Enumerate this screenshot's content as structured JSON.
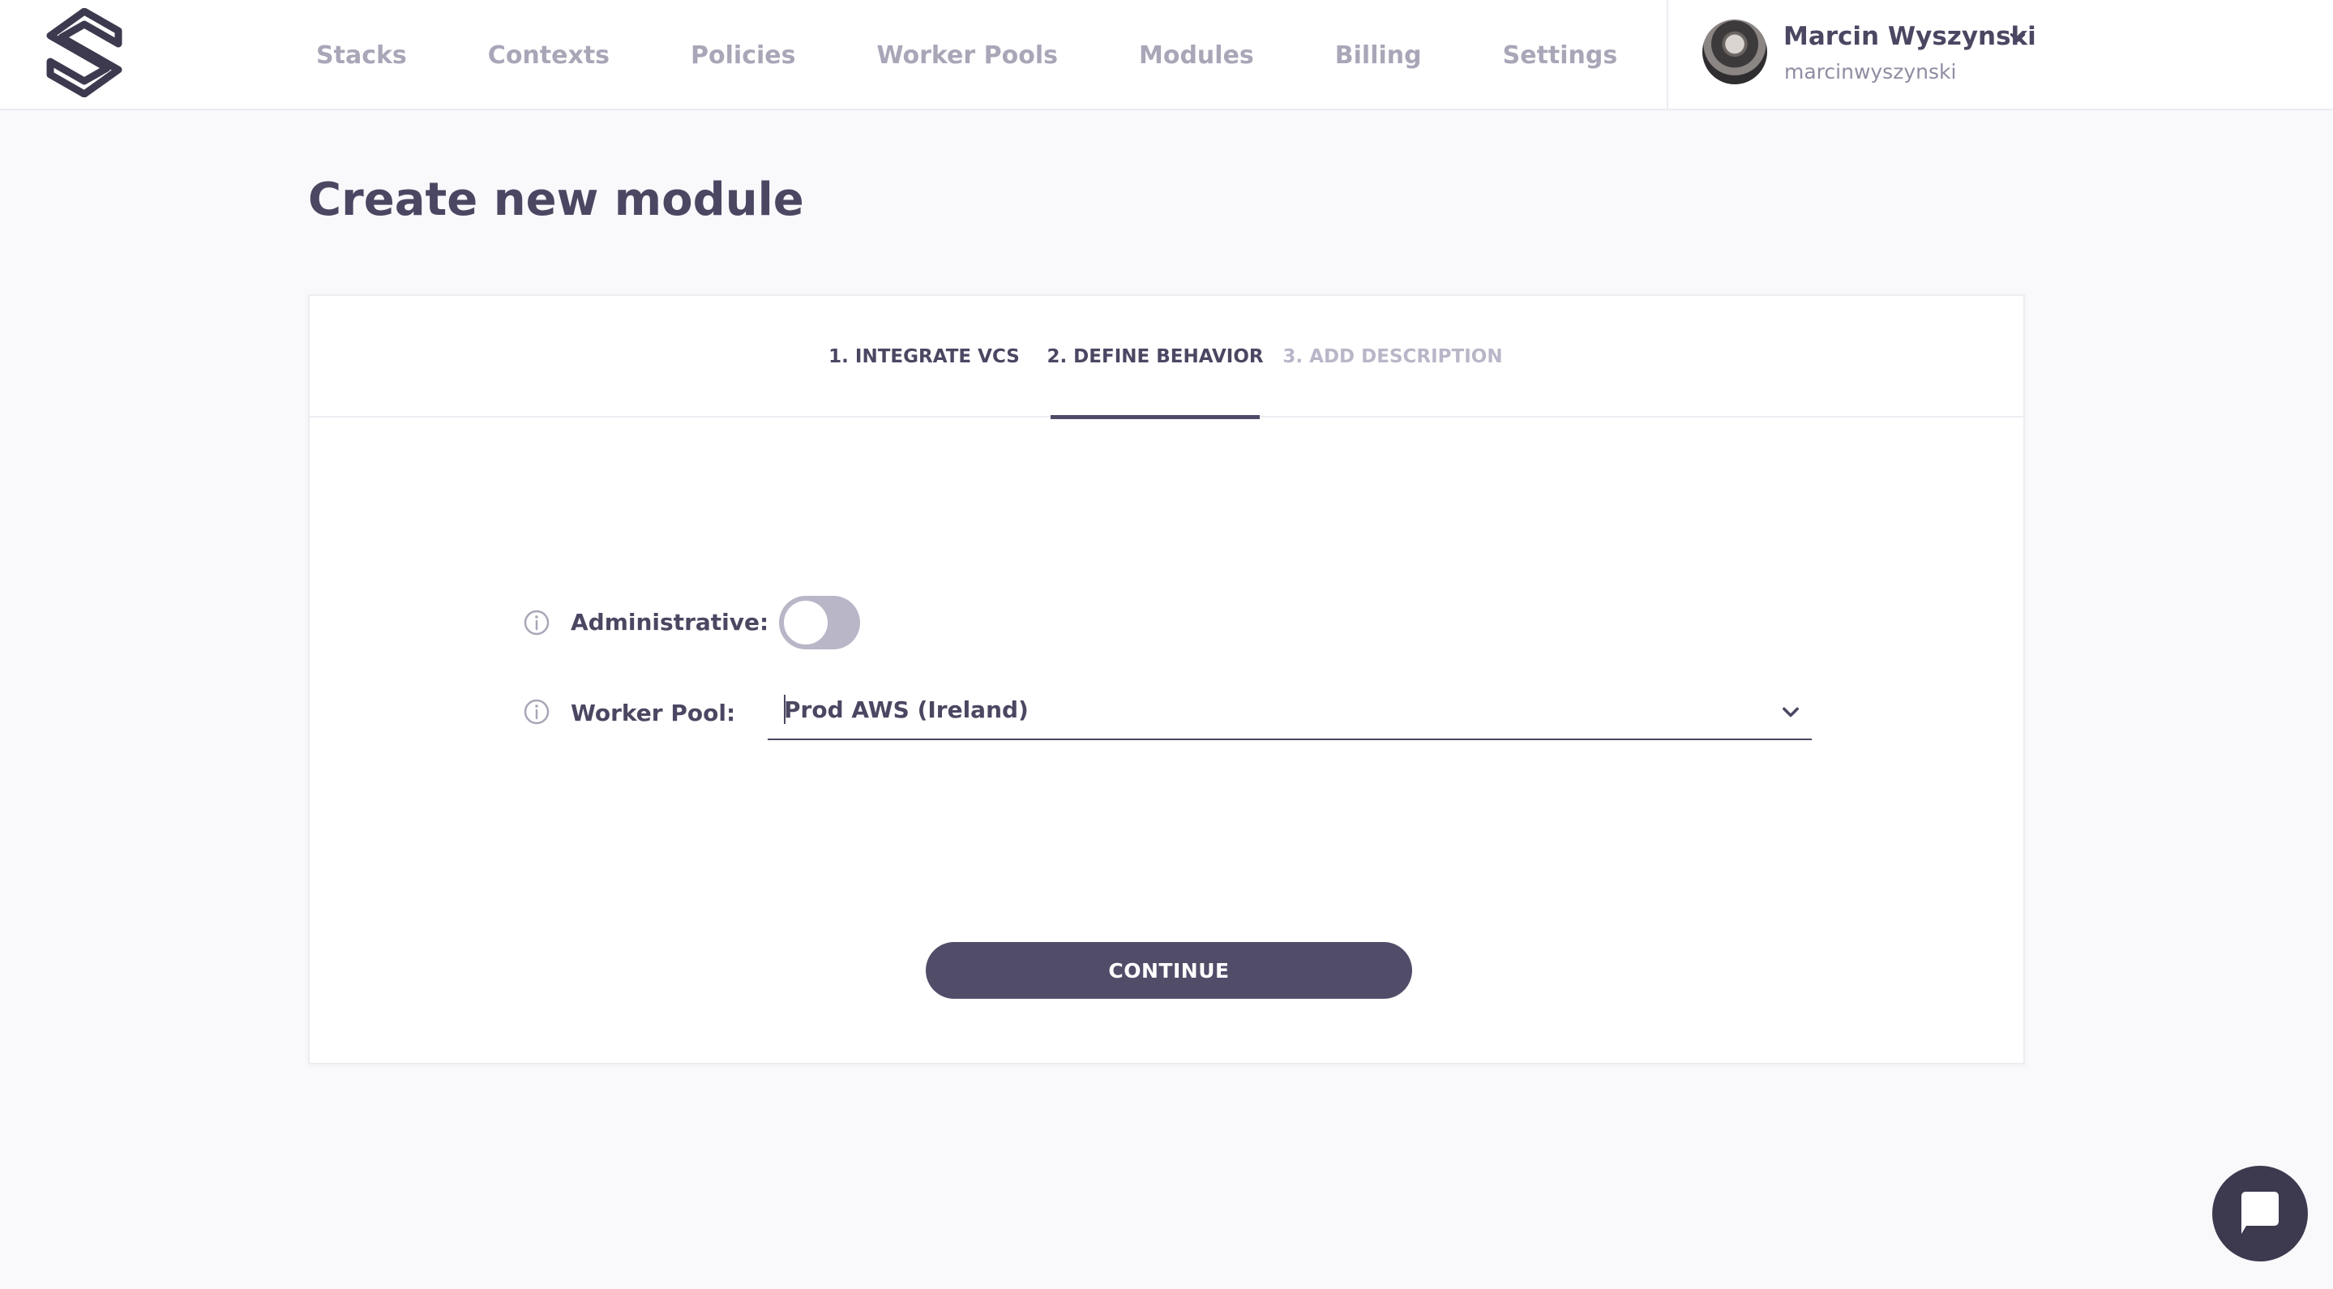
{
  "nav": {
    "items": [
      "Stacks",
      "Contexts",
      "Policies",
      "Worker Pools",
      "Modules",
      "Billing",
      "Settings"
    ]
  },
  "user": {
    "name": "Marcin Wyszynski",
    "handle": "marcinwyszynski"
  },
  "page": {
    "title": "Create new module"
  },
  "steps": [
    {
      "label": "1. INTEGRATE VCS",
      "state": "done"
    },
    {
      "label": "2. DEFINE BEHAVIOR",
      "state": "active"
    },
    {
      "label": "3. ADD DESCRIPTION",
      "state": "pending"
    }
  ],
  "form": {
    "administrative": {
      "label": "Administrative:",
      "enabled": false
    },
    "worker_pool": {
      "label": "Worker Pool:",
      "value": "Prod AWS (Ireland)"
    },
    "continue_label": "CONTINUE"
  },
  "icons": {
    "logo": "spacelift-logo-icon",
    "info": "info-icon",
    "chevron": "chevron-down-icon",
    "chat": "chat-icon"
  },
  "colors": {
    "accent": "#514d69",
    "muted_text": "#a9a6b8",
    "toggle_off": "#b9b6c8",
    "background": "#f9f9fc"
  }
}
